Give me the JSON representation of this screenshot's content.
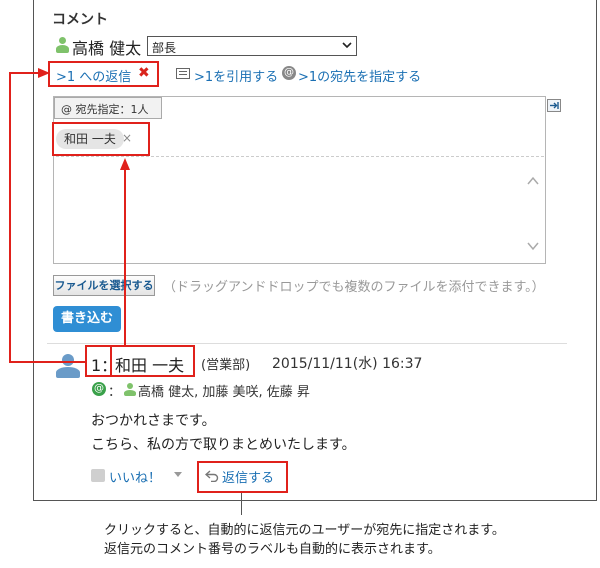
{
  "comment": {
    "section_title": "コメント",
    "poster_name": "高橋 健太",
    "department_value": "部長",
    "reply_label": ">1 への返信",
    "reply_cancel_icon": "close-icon",
    "quote_link": ">1を引用する",
    "address_link": ">1の宛先を指定する"
  },
  "editor": {
    "address_header": "@ 宛先指定：1人",
    "address_chip": "和田 一夫",
    "chip_remove": "×",
    "file_button": "ファイルを選択する",
    "file_hint": "（ドラッグアンドドロップでも複数のファイルを添付できます。）",
    "submit_button": "書き込む"
  },
  "post": {
    "number": "1：",
    "author": "和田 一夫",
    "department": "(営業部)",
    "timestamp": "2015/11/11(水) 16:37",
    "address_prefix": "：",
    "recipients": "高橋 健太, 加藤 美咲, 佐藤 昇",
    "body_line1": "おつかれさまです。",
    "body_line2": "こちら、私の方で取りまとめいたします。",
    "like_label": "いいね！",
    "reply_action": "返信する"
  },
  "caption": {
    "line1": "クリックすると、自動的に返信元のユーザーが宛先に指定されます。",
    "line2": "返信元のコメント番号のラベルも自動的に表示されます。"
  },
  "colors": {
    "link": "#1a6fb3",
    "highlight": "#e0211b",
    "submit": "#2f8ed4",
    "user_icon": "#7fc26b"
  }
}
